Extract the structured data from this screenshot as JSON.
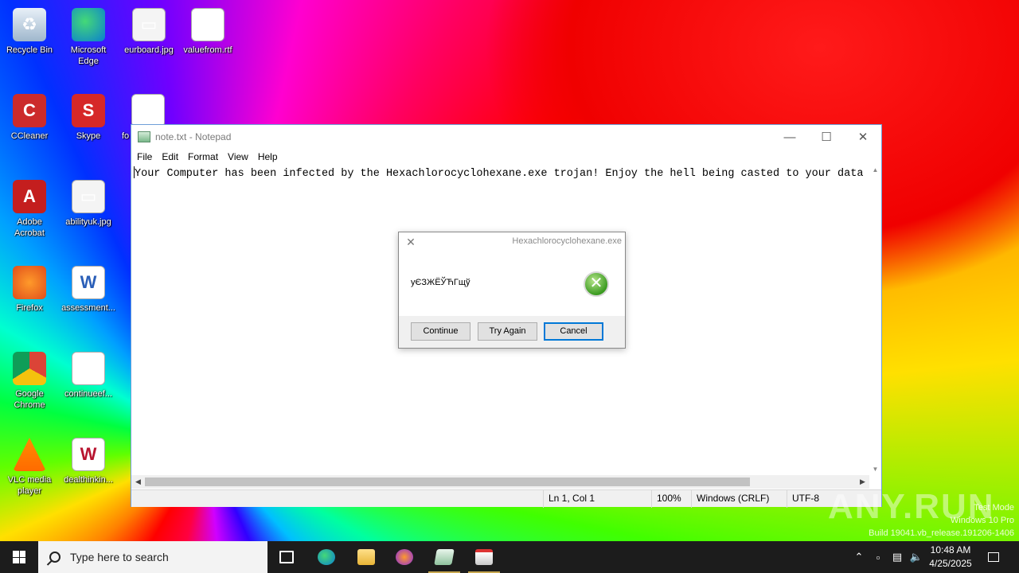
{
  "desktop": {
    "icons": [
      {
        "label": "Recycle Bin",
        "icon": "recycle-bin-icon"
      },
      {
        "label": "Microsoft Edge",
        "icon": "edge-icon"
      },
      {
        "label": "eurboard.jpg",
        "icon": "image-file-icon"
      },
      {
        "label": "valuefrom.rtf",
        "icon": "word-doc-icon"
      },
      {
        "label": "CCleaner",
        "icon": "ccleaner-icon"
      },
      {
        "label": "Skype",
        "icon": "skype-icon"
      },
      {
        "label": "fo",
        "icon": "word-doc-icon"
      },
      {
        "label": "Adobe Acrobat",
        "icon": "acrobat-icon"
      },
      {
        "label": "abilityuk.jpg",
        "icon": "image-file-icon"
      },
      {
        "label": "Firefox",
        "icon": "firefox-icon"
      },
      {
        "label": "assessment...",
        "icon": "word-doc-icon"
      },
      {
        "label": "Google Chrome",
        "icon": "chrome-icon"
      },
      {
        "label": "continueef...",
        "icon": "word-doc-icon"
      },
      {
        "label": "VLC media player",
        "icon": "vlc-icon"
      },
      {
        "label": "dealthinkin...",
        "icon": "word-doc-icon"
      }
    ]
  },
  "notepad": {
    "title": "note.txt - Notepad",
    "menu": [
      "File",
      "Edit",
      "Format",
      "View",
      "Help"
    ],
    "content": "Your Computer has been infected by the Hexachlorocyclohexane.exe trojan! Enjoy the hell being casted to your data a",
    "status": {
      "position": "Ln 1, Col 1",
      "zoom": "100%",
      "line_ending": "Windows (CRLF)",
      "encoding": "UTF-8"
    }
  },
  "msgbox": {
    "title": "Hexachlorocyclohexane.exe",
    "message": "уЄЗЖЁЎЋГщў",
    "buttons": {
      "continue": "Continue",
      "try_again": "Try Again",
      "cancel": "Cancel"
    }
  },
  "watermark": {
    "brand": "ANY.RUN",
    "mode": "Test Mode",
    "edition": "Windows 10 Pro",
    "build": "Build 19041.vb_release.191206-1406"
  },
  "taskbar": {
    "search_placeholder": "Type here to search",
    "time": "10:48 AM",
    "date": "4/25/2025"
  }
}
